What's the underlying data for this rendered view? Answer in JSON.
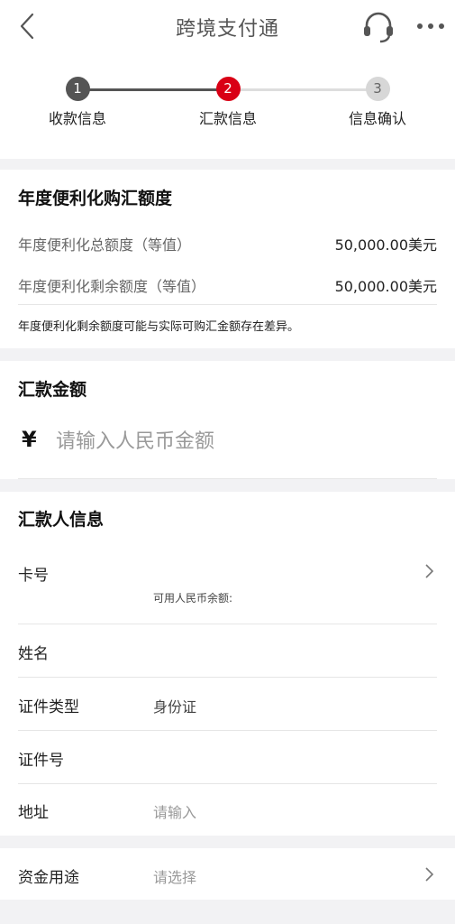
{
  "header": {
    "title": "跨境支付通",
    "back_icon": "chevron-left-icon",
    "service_icon": "headset-icon",
    "more_icon": "more-dots-icon"
  },
  "steps": [
    {
      "num": "1",
      "label": "收款信息",
      "state": "done"
    },
    {
      "num": "2",
      "label": "汇款信息",
      "state": "active"
    },
    {
      "num": "3",
      "label": "信息确认",
      "state": "todo"
    }
  ],
  "quota": {
    "title": "年度便利化购汇额度",
    "total_label": "年度便利化总额度（等值）",
    "total_value": "50,000.00美元",
    "remain_label": "年度便利化剩余额度（等值）",
    "remain_value": "50,000.00美元",
    "note": "年度便利化剩余额度可能与实际可购汇金额存在差异。"
  },
  "amount": {
    "title": "汇款金额",
    "currency_symbol": "¥",
    "placeholder": "请输入人民币金额"
  },
  "remitter": {
    "title": "汇款人信息",
    "card_label": "卡号",
    "balance_label": "可用人民币余额:",
    "name_label": "姓名",
    "id_type_label": "证件类型",
    "id_type_value": "身份证",
    "id_no_label": "证件号",
    "address_label": "地址",
    "address_placeholder": "请输入"
  },
  "purpose": {
    "label": "资金用途",
    "placeholder": "请选择"
  },
  "colors": {
    "accent_red": "#d90015",
    "done_gray": "#555555",
    "todo_gray": "#d7d7d7"
  }
}
